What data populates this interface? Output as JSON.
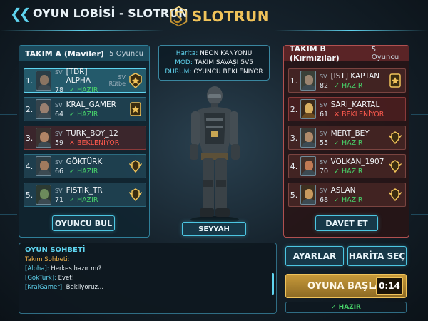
{
  "header": {
    "title": "OYUN LOBİSİ - SLOTRUN",
    "logo_text": "SLOTRUN"
  },
  "team_a": {
    "name": "TAKIM A (Maviler)",
    "count": "5 Oyuncu",
    "players": [
      {
        "num": "1.",
        "sv": "SV",
        "name": "[TDR] ALPHA",
        "level": "78",
        "status": "✓ HAZIR",
        "ready": true,
        "rank_label_top": "SV",
        "rank_label_bottom": "Rütbe"
      },
      {
        "num": "2.",
        "sv": "SV",
        "name": "KRAL_GAMER",
        "level": "64",
        "status": "✓ HAZIR",
        "ready": true
      },
      {
        "num": "3.",
        "sv": "SV",
        "name": "TURK_BOY_12",
        "level": "59",
        "status": "✕ BEKLENİYOR",
        "ready": false
      },
      {
        "num": "4.",
        "sv": "SV",
        "name": "GÖKTÜRK",
        "level": "66",
        "status": "✓ HAZIR",
        "ready": true
      },
      {
        "num": "5.",
        "sv": "SV",
        "name": "FISTIK_TR",
        "level": "71",
        "status": "✓ HAZIR",
        "ready": true
      }
    ],
    "button_label": "OYUNCU BUL"
  },
  "team_b": {
    "name": "TAKIM B (Kırmızılar)",
    "count": "5 Oyuncu",
    "players": [
      {
        "num": "1.",
        "sv": "SV",
        "name": "[IST] KAPTAN",
        "level": "82",
        "status": "✓ HAZIR",
        "ready": true
      },
      {
        "num": "2.",
        "sv": "SV",
        "name": "SARI_KARTAL",
        "level": "61",
        "status": "✕ BEKLENİYOR",
        "ready": false
      },
      {
        "num": "3.",
        "sv": "SV",
        "name": "MERT_BEY",
        "level": "55",
        "status": "✓ HAZIR",
        "ready": true
      },
      {
        "num": "4.",
        "sv": "SV",
        "name": "VOLKAN_1907",
        "level": "70",
        "status": "✓ HAZIR",
        "ready": true
      },
      {
        "num": "5.",
        "sv": "SV",
        "name": "ASLAN",
        "level": "68",
        "status": "✓ HAZIR",
        "ready": true
      }
    ],
    "button_label": "DAVET ET"
  },
  "match_info": {
    "map_key": "Harita:",
    "map_value": "NEON KANYONU",
    "mode_key": "MOD:",
    "mode_value": "TAKIM SAVAŞI 5V5",
    "state_key": "DURUM:",
    "state_value": "OYUNCU BEKLENİYOR"
  },
  "character": {
    "name": "SEYYAH"
  },
  "chat": {
    "title": "OYUN SOHBETİ",
    "subtitle": "Takım Sohbeti:",
    "messages": [
      {
        "user": "[Alpha]:",
        "text": "Herkes hazır mı?"
      },
      {
        "user": "[GokTurk]:",
        "text": "Evet!"
      },
      {
        "user": "[KralGamer]:",
        "text": "Bekliyoruz..."
      }
    ]
  },
  "actions": {
    "settings_label": "AYARLAR",
    "map_select_label": "HARİTA SEÇ",
    "start_label": "OYUNA BAŞLA",
    "timer": "0:14",
    "ready_label": "✓ HAZIR"
  },
  "colors": {
    "accent_cyan": "#5fd4ef",
    "gold": "#f0c35a",
    "ready_green": "#48d46a",
    "waiting_red": "#ff5a4e",
    "team_b_red": "#b05050"
  },
  "icons": {
    "back": "double-chevron-left-icon",
    "logo": "slotrun-logo-icon",
    "rank": "rank-badge-icon",
    "rank_gold": "rank-star-badge-icon"
  }
}
